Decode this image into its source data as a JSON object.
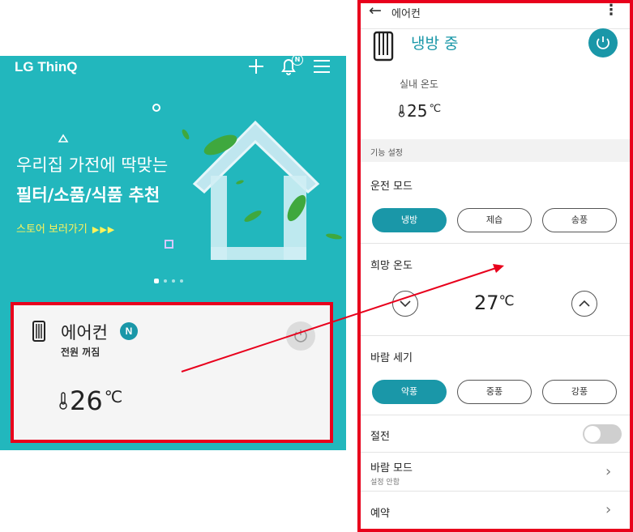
{
  "colors": {
    "teal": "#22b7bd",
    "accent": "#1a97a8",
    "highlight": "#e8001c",
    "link": "#fff35a"
  },
  "home": {
    "app_title": "LG ThinQ",
    "icons": [
      "plus-icon",
      "bell-icon",
      "menu-icon"
    ],
    "notification_badge": "N",
    "banner": {
      "line1": "우리집 가전에 딱맞는",
      "line2": "필터/소품/식품 추천",
      "link": "스토어 보러가기",
      "link_arrows": "▶▶▶"
    },
    "carousel": {
      "count": 4,
      "active": 1
    },
    "device_card": {
      "name": "에어컨",
      "new_badge": "N",
      "status": "전원 꺼짐",
      "temperature": "26",
      "unit": "℃"
    }
  },
  "detail": {
    "title": "에어컨",
    "status": "냉방 중",
    "indoor_label": "실내 온도",
    "indoor_temp": "25",
    "indoor_unit": "℃",
    "section_label": "기능 설정",
    "mode": {
      "label": "운전 모드",
      "options": [
        "냉방",
        "제습",
        "송풍"
      ],
      "selected": "냉방"
    },
    "target": {
      "label": "희망 온도",
      "value": "27",
      "unit": "℃"
    },
    "fan": {
      "label": "바람 세기",
      "options": [
        "약풍",
        "중풍",
        "강풍"
      ],
      "selected": "약풍"
    },
    "power_saving": {
      "label": "절전",
      "on": false
    },
    "wind_mode": {
      "label": "바람 모드",
      "sub": "설정 안함"
    },
    "reservation": {
      "label": "예약"
    }
  }
}
